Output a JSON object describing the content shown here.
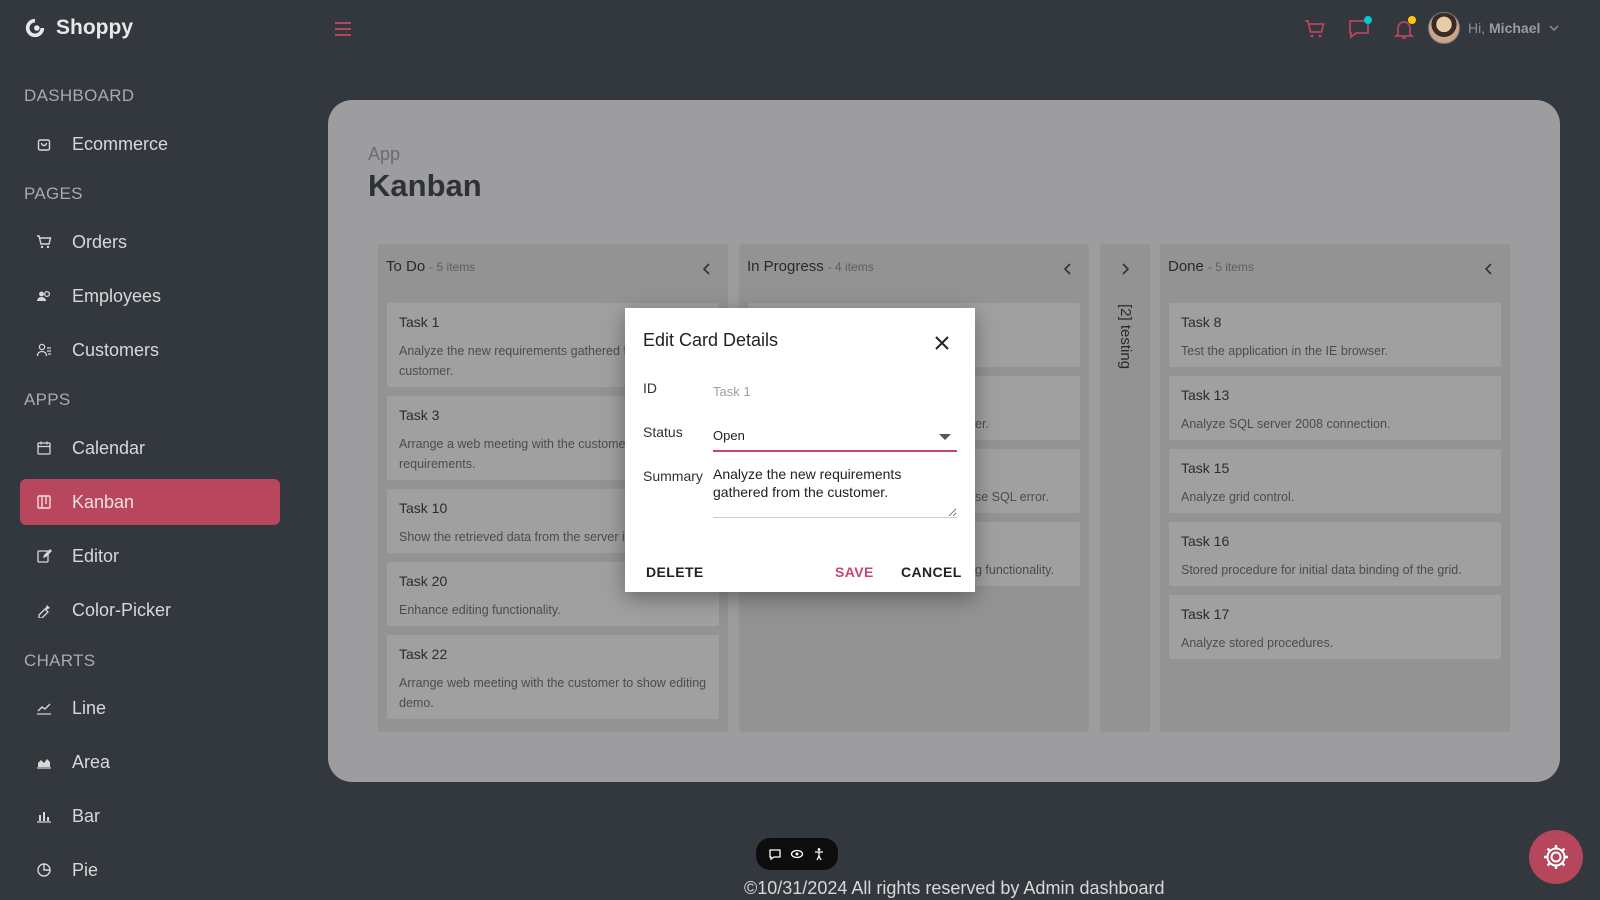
{
  "app": {
    "name": "Shoppy"
  },
  "sidebar": {
    "sections": [
      {
        "title": "DASHBOARD",
        "items": [
          {
            "label": "Ecommerce",
            "icon": "shopping-bag-icon"
          }
        ]
      },
      {
        "title": "PAGES",
        "items": [
          {
            "label": "Orders",
            "icon": "cart-icon"
          },
          {
            "label": "Employees",
            "icon": "people-icon"
          },
          {
            "label": "Customers",
            "icon": "customers-icon"
          }
        ]
      },
      {
        "title": "APPS",
        "items": [
          {
            "label": "Calendar",
            "icon": "calendar-icon"
          },
          {
            "label": "Kanban",
            "icon": "kanban-icon",
            "active": true
          },
          {
            "label": "Editor",
            "icon": "edit-icon"
          },
          {
            "label": "Color-Picker",
            "icon": "color-picker-icon"
          }
        ]
      },
      {
        "title": "CHARTS",
        "items": [
          {
            "label": "Line",
            "icon": "line-chart-icon"
          },
          {
            "label": "Area",
            "icon": "area-chart-icon"
          },
          {
            "label": "Bar",
            "icon": "bar-chart-icon"
          },
          {
            "label": "Pie",
            "icon": "pie-chart-icon"
          }
        ]
      }
    ]
  },
  "topbar": {
    "greeting": "Hi,",
    "user_name": "Michael",
    "accent": "#c8456b"
  },
  "page": {
    "breadcrumb": "App",
    "title": "Kanban"
  },
  "kanban": {
    "columns": [
      {
        "title": "To Do",
        "count": "- 5 items",
        "cards": [
          {
            "title": "Task 1",
            "summary": "Analyze the new requirements gathered from the customer."
          },
          {
            "title": "Task 3",
            "summary": "Arrange a web meeting with the customer to get new requirements."
          },
          {
            "title": "Task 10",
            "summary": "Show the retrieved data from the server in grid control."
          },
          {
            "title": "Task 20",
            "summary": "Enhance editing functionality."
          },
          {
            "title": "Task 22",
            "summary": "Arrange web meeting with the customer to show editing demo."
          }
        ]
      },
      {
        "title": "In Progress",
        "count": "- 4 items",
        "cards": [
          {
            "title": "",
            "summary": ""
          },
          {
            "title": "",
            "summary": "er."
          },
          {
            "title": "",
            "summary": "se SQL error."
          },
          {
            "title": "",
            "summary": "g functionality."
          }
        ]
      },
      {
        "title": "[2] testing",
        "collapsed": true
      },
      {
        "title": "Done",
        "count": "- 5 items",
        "cards": [
          {
            "title": "Task 8",
            "summary": "Test the application in the IE browser."
          },
          {
            "title": "Task 13",
            "summary": "Analyze SQL server 2008 connection."
          },
          {
            "title": "Task 15",
            "summary": "Analyze grid control."
          },
          {
            "title": "Task 16",
            "summary": "Stored procedure for initial data binding of the grid."
          },
          {
            "title": "Task 17",
            "summary": "Analyze stored procedures."
          }
        ]
      }
    ]
  },
  "dialog": {
    "title": "Edit Card Details",
    "id_label": "ID",
    "id_value": "Task 1",
    "status_label": "Status",
    "status_value": "Open",
    "summary_label": "Summary",
    "summary_value": "Analyze the new requirements gathered from the customer.",
    "delete_label": "DELETE",
    "save_label": "SAVE",
    "cancel_label": "CANCEL"
  },
  "footer": {
    "text": "©10/31/2024 All rights reserved by Admin dashboard"
  }
}
